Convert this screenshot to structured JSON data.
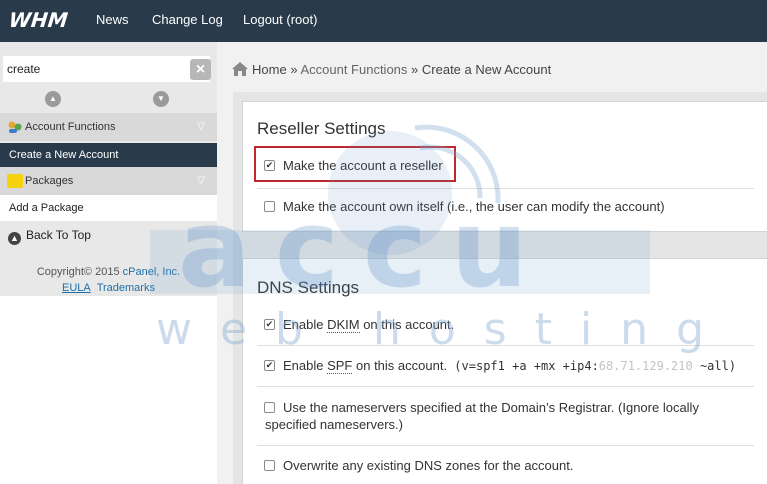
{
  "header": {
    "logo": "WHM",
    "nav": [
      {
        "label": "News"
      },
      {
        "label": "Change Log"
      },
      {
        "label": "Logout (root)"
      }
    ]
  },
  "sidebar": {
    "search_value": "create",
    "categories": [
      {
        "label": "Account Functions",
        "icon": "account-functions-icon",
        "item": "Create a New Account"
      },
      {
        "label": "Packages",
        "icon": "folder-icon",
        "item": "Add a Package"
      }
    ],
    "back_to_top": "Back To Top",
    "copyright_prefix": "Copyright© 2015",
    "copyright_company": "cPanel, Inc.",
    "eula": "EULA",
    "trademarks": "Trademarks"
  },
  "breadcrumb": {
    "home": "Home",
    "sep": "»",
    "section": "Account Functions",
    "current": "Create a New Account"
  },
  "reseller_settings": {
    "title": "Reseller Settings",
    "options": [
      {
        "label": "Make the account a reseller",
        "checked": true
      },
      {
        "label": "Make the account own itself (i.e., the user can modify the account)",
        "checked": false
      }
    ]
  },
  "dns_settings": {
    "title": "DNS Settings",
    "dkim": {
      "pre": "Enable ",
      "abbr": "DKIM",
      "post": " on this account.",
      "checked": true
    },
    "spf": {
      "pre": "Enable ",
      "abbr": "SPF",
      "post": " on this account.",
      "record_pre": "(v=spf1 +a +mx +ip4:",
      "record_ip": "68.71.129.210",
      "record_post": " ~all)",
      "checked": true
    },
    "nameservers": {
      "line1": "Use the nameservers specified at the Domain’s Registrar. (Ignore locally",
      "line2": "specified nameservers.)",
      "checked": false
    },
    "overwrite": {
      "label": "Overwrite any existing DNS zones for the account.",
      "checked": false
    }
  },
  "watermark": {
    "brand": "accu",
    "tagline": "web hosting"
  },
  "colors": {
    "topbar": "#293a4a",
    "active_item": "#293a4a",
    "highlight_box": "#c0272d",
    "link": "#1e6fa8"
  }
}
